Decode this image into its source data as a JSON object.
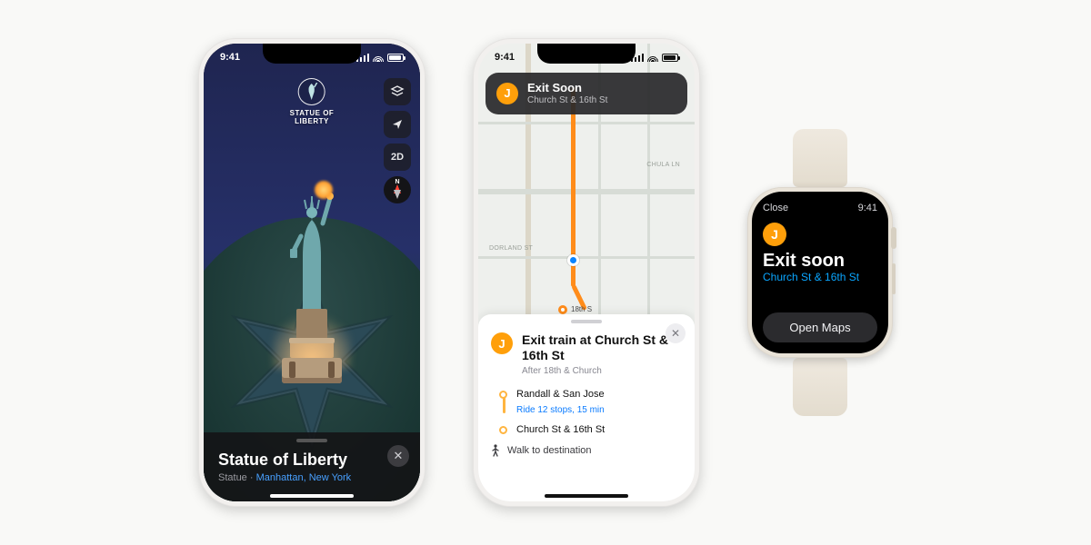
{
  "statusbar": {
    "time": "9:41"
  },
  "phone1": {
    "landmark_label": "STATUE OF\nLIBERTY",
    "controls": {
      "mode_2d": "2D",
      "compass_cardinal": "N"
    },
    "card": {
      "title": "Statue of Liberty",
      "category": "Statue",
      "location": "Manhattan, New York"
    }
  },
  "phone2": {
    "banner": {
      "line_letter": "J",
      "title": "Exit Soon",
      "subtitle": "Church St & 16th St"
    },
    "map_labels": {
      "chula": "CHULA LN",
      "dorland": "DORLAND ST",
      "endpoint": "18th S"
    },
    "sheet": {
      "line_letter": "J",
      "title": "Exit train at Church St & 16th St",
      "subtitle": "After 18th & Church",
      "stop_start": "Randall & San Jose",
      "ride_info": "Ride 12 stops, 15 min",
      "stop_end": "Church St & 16th St",
      "walk": "Walk to destination"
    }
  },
  "watch": {
    "close_label": "Close",
    "time": "9:41",
    "line_letter": "J",
    "title": "Exit soon",
    "subtitle": "Church St & 16th St",
    "open_maps": "Open Maps"
  }
}
